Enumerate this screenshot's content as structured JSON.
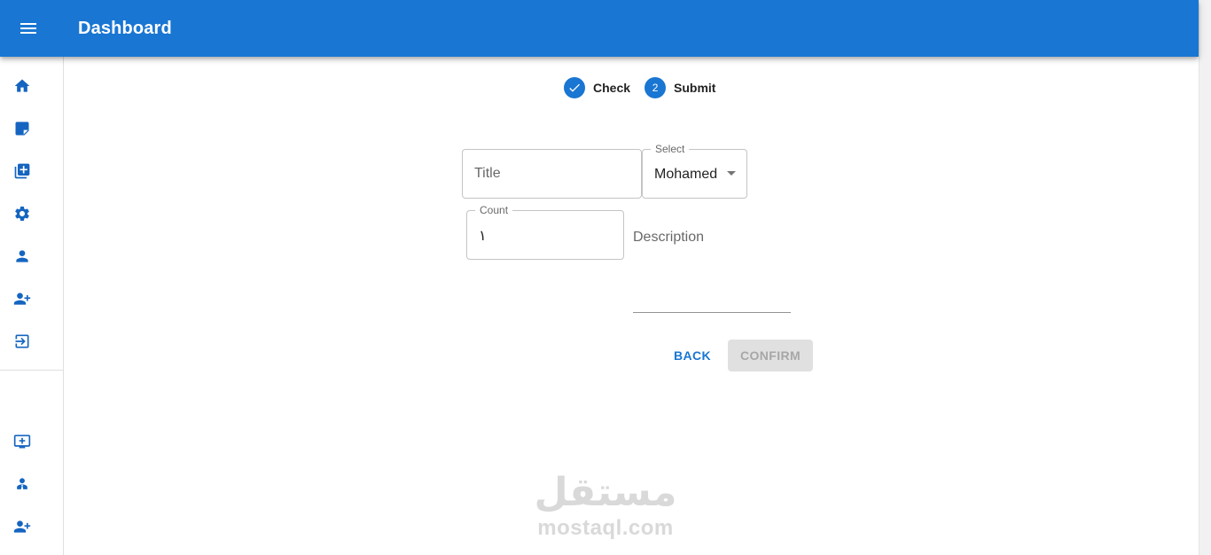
{
  "appbar": {
    "title": "Dashboard",
    "menu_icon": "menu-icon",
    "color": "#1976d2"
  },
  "sidebar": {
    "top_items": [
      {
        "icon": "home-icon"
      },
      {
        "icon": "note-icon"
      },
      {
        "icon": "library-add-icon"
      },
      {
        "icon": "settings-icon"
      },
      {
        "icon": "person-icon"
      },
      {
        "icon": "person-add-icon"
      },
      {
        "icon": "logout-icon"
      }
    ],
    "bottom_items": [
      {
        "icon": "add-to-queue-icon"
      },
      {
        "icon": "supervisor-icon"
      },
      {
        "icon": "person-add-icon"
      }
    ]
  },
  "stepper": {
    "steps": [
      {
        "label": "Check",
        "state": "completed"
      },
      {
        "label": "Submit",
        "number": "2",
        "state": "active"
      }
    ]
  },
  "form": {
    "title": {
      "placeholder": "Title"
    },
    "select": {
      "label": "Select",
      "value": "Mohamed"
    },
    "count": {
      "label": "Count",
      "value": "١"
    },
    "description": {
      "placeholder": "Description"
    }
  },
  "actions": {
    "back_label": "BACK",
    "confirm_label": "CONFIRM"
  },
  "watermark": {
    "arabic": "مستقل",
    "latin": "mostaql.com"
  }
}
